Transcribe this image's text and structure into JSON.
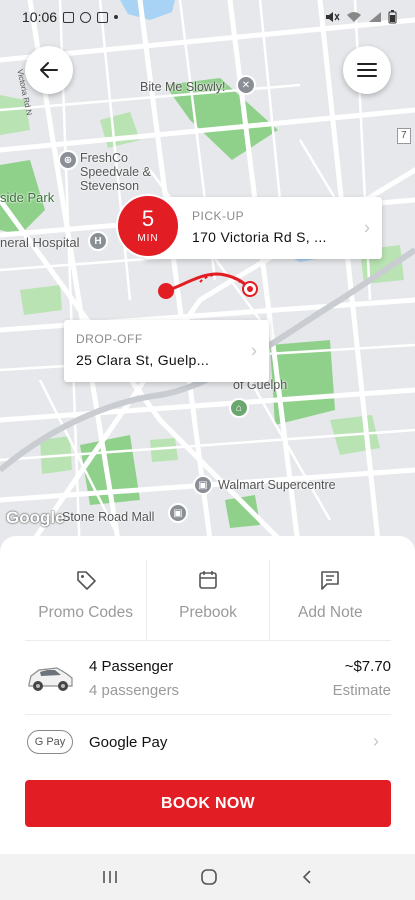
{
  "status_bar": {
    "time": "10:06"
  },
  "map": {
    "labels": {
      "bite_me_slowly": "Bite Me Slowly!",
      "freshco": "FreshCo Speedvale & Stevenson",
      "side_park": "side Park",
      "hospital": "neral Hospital",
      "walmart": "Walmart Supercentre",
      "stone_road": "Stone Road Mall",
      "guelph": "of Guelph",
      "victoria_rd": "Victoria Rd N",
      "google": "Google",
      "route_7": "7"
    }
  },
  "pickup": {
    "eta_value": "5",
    "eta_unit": "MIN",
    "caption": "PICK-UP",
    "address": "170 Victoria Rd S, ..."
  },
  "dropoff": {
    "caption": "DROP-OFF",
    "address": "25 Clara St, Guelp..."
  },
  "options": {
    "promo": "Promo Codes",
    "prebook": "Prebook",
    "note": "Add Note"
  },
  "vehicle": {
    "title": "4 Passenger",
    "subtitle": "4 passengers",
    "price": "~$7.70",
    "price_note": "Estimate"
  },
  "payment": {
    "badge": "G Pay",
    "name": "Google Pay"
  },
  "book_button": "BOOK NOW",
  "colors": {
    "accent": "#e31d24",
    "park": "#8fd18a",
    "map_bg": "#e8eaed"
  }
}
